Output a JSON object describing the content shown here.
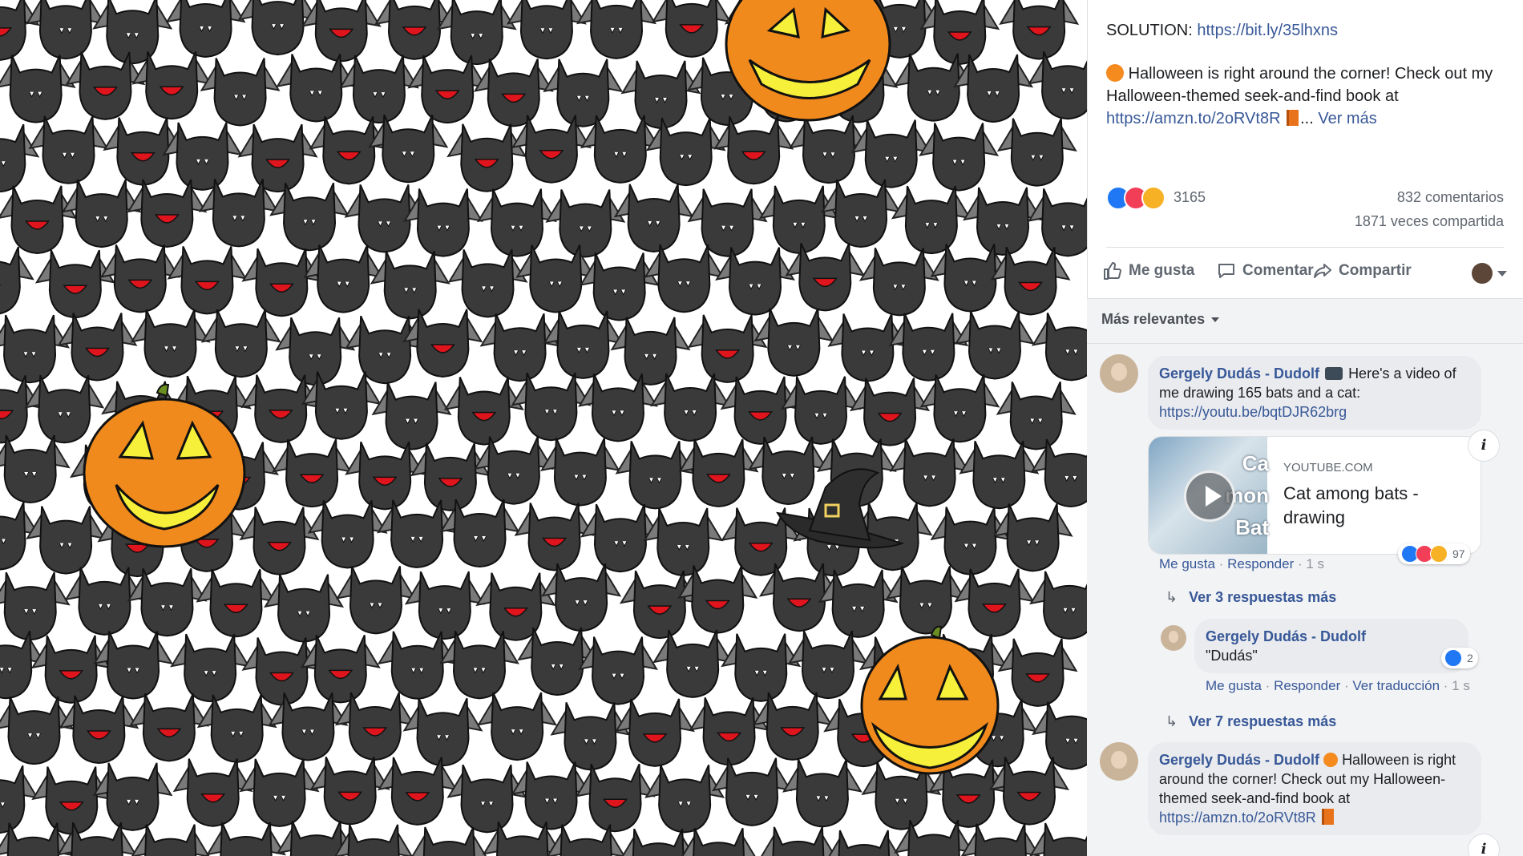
{
  "post": {
    "solution_label": "SOLUTION:",
    "solution_link": "https://bit.ly/35lhxns",
    "caption_text": "Halloween is right around the corner! Check out my Halloween-themed seek-and-find book at",
    "caption_link": "https://amzn.to/2oRVt8R",
    "ellipsis": "...",
    "see_more": "Ver más",
    "reaction_count": "3165",
    "comment_count": "832 comentarios",
    "share_count": "1871 veces compartida",
    "reactions": [
      "like",
      "love",
      "haha"
    ]
  },
  "actions": {
    "like": "Me gusta",
    "comment": "Comentar",
    "share": "Compartir"
  },
  "sort": {
    "label": "Más relevantes"
  },
  "comments": [
    {
      "author": "Gergely Dudás - Dudolf",
      "text": "Here's a video of me drawing 165 bats and a cat:",
      "link": "https://youtu.be/bqtDJR62brg",
      "card": {
        "domain": "YOUTUBE.COM",
        "title": "Cat among bats - drawing",
        "thumb_lines": [
          "Ca",
          "mon",
          "Bat"
        ]
      },
      "reaction_count": "97",
      "reply_actions": [
        "Me gusta",
        "Responder"
      ],
      "time": "1 s"
    },
    {
      "author": "Gergely Dudás - Dudolf",
      "text": "Halloween is right around the corner! Check out my Halloween-themed seek-and-find book at",
      "link": "https://amzn.to/2oRVt8R"
    }
  ],
  "replies_more_1": "Ver 3 respuestas más",
  "reply": {
    "author": "Gergely Dudás - Dudolf",
    "text": "\"Dudás\"",
    "reaction_count": "2",
    "actions": [
      "Me gusta",
      "Responder",
      "Ver traducción"
    ],
    "time": "1 s"
  },
  "replies_more_2": "Ver 7 respuestas más",
  "colors": {
    "link": "#385898",
    "bat": "#3a3a3a",
    "pumpkin": "#f08a1c",
    "mouth": "#e0141c"
  },
  "icons": [
    "like-icon",
    "comment-icon",
    "share-icon",
    "info-icon",
    "play-icon",
    "reply-arrow-icon"
  ]
}
